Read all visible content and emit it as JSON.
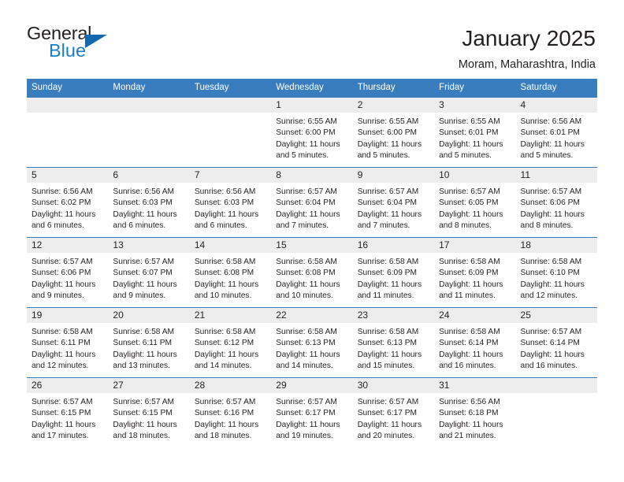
{
  "brand": {
    "name_part1": "General",
    "name_part2": "Blue",
    "triangle_color": "#1568b0",
    "blue_color": "#1a7ec8"
  },
  "header": {
    "title": "January 2025",
    "subtitle": "Moram, Maharashtra, India"
  },
  "theme": {
    "header_blue": "#3a7dbf",
    "daynum_bg": "#ededed",
    "text": "#231f20"
  },
  "weekdays": [
    "Sunday",
    "Monday",
    "Tuesday",
    "Wednesday",
    "Thursday",
    "Friday",
    "Saturday"
  ],
  "weeks": [
    [
      {
        "day": "",
        "blank": true
      },
      {
        "day": "",
        "blank": true
      },
      {
        "day": "",
        "blank": true
      },
      {
        "day": "1",
        "sunrise": "Sunrise: 6:55 AM",
        "sunset": "Sunset: 6:00 PM",
        "daylight1": "Daylight: 11 hours",
        "daylight2": "and 5 minutes."
      },
      {
        "day": "2",
        "sunrise": "Sunrise: 6:55 AM",
        "sunset": "Sunset: 6:00 PM",
        "daylight1": "Daylight: 11 hours",
        "daylight2": "and 5 minutes."
      },
      {
        "day": "3",
        "sunrise": "Sunrise: 6:55 AM",
        "sunset": "Sunset: 6:01 PM",
        "daylight1": "Daylight: 11 hours",
        "daylight2": "and 5 minutes."
      },
      {
        "day": "4",
        "sunrise": "Sunrise: 6:56 AM",
        "sunset": "Sunset: 6:01 PM",
        "daylight1": "Daylight: 11 hours",
        "daylight2": "and 5 minutes."
      }
    ],
    [
      {
        "day": "5",
        "sunrise": "Sunrise: 6:56 AM",
        "sunset": "Sunset: 6:02 PM",
        "daylight1": "Daylight: 11 hours",
        "daylight2": "and 6 minutes."
      },
      {
        "day": "6",
        "sunrise": "Sunrise: 6:56 AM",
        "sunset": "Sunset: 6:03 PM",
        "daylight1": "Daylight: 11 hours",
        "daylight2": "and 6 minutes."
      },
      {
        "day": "7",
        "sunrise": "Sunrise: 6:56 AM",
        "sunset": "Sunset: 6:03 PM",
        "daylight1": "Daylight: 11 hours",
        "daylight2": "and 6 minutes."
      },
      {
        "day": "8",
        "sunrise": "Sunrise: 6:57 AM",
        "sunset": "Sunset: 6:04 PM",
        "daylight1": "Daylight: 11 hours",
        "daylight2": "and 7 minutes."
      },
      {
        "day": "9",
        "sunrise": "Sunrise: 6:57 AM",
        "sunset": "Sunset: 6:04 PM",
        "daylight1": "Daylight: 11 hours",
        "daylight2": "and 7 minutes."
      },
      {
        "day": "10",
        "sunrise": "Sunrise: 6:57 AM",
        "sunset": "Sunset: 6:05 PM",
        "daylight1": "Daylight: 11 hours",
        "daylight2": "and 8 minutes."
      },
      {
        "day": "11",
        "sunrise": "Sunrise: 6:57 AM",
        "sunset": "Sunset: 6:06 PM",
        "daylight1": "Daylight: 11 hours",
        "daylight2": "and 8 minutes."
      }
    ],
    [
      {
        "day": "12",
        "sunrise": "Sunrise: 6:57 AM",
        "sunset": "Sunset: 6:06 PM",
        "daylight1": "Daylight: 11 hours",
        "daylight2": "and 9 minutes."
      },
      {
        "day": "13",
        "sunrise": "Sunrise: 6:57 AM",
        "sunset": "Sunset: 6:07 PM",
        "daylight1": "Daylight: 11 hours",
        "daylight2": "and 9 minutes."
      },
      {
        "day": "14",
        "sunrise": "Sunrise: 6:58 AM",
        "sunset": "Sunset: 6:08 PM",
        "daylight1": "Daylight: 11 hours",
        "daylight2": "and 10 minutes."
      },
      {
        "day": "15",
        "sunrise": "Sunrise: 6:58 AM",
        "sunset": "Sunset: 6:08 PM",
        "daylight1": "Daylight: 11 hours",
        "daylight2": "and 10 minutes."
      },
      {
        "day": "16",
        "sunrise": "Sunrise: 6:58 AM",
        "sunset": "Sunset: 6:09 PM",
        "daylight1": "Daylight: 11 hours",
        "daylight2": "and 11 minutes."
      },
      {
        "day": "17",
        "sunrise": "Sunrise: 6:58 AM",
        "sunset": "Sunset: 6:09 PM",
        "daylight1": "Daylight: 11 hours",
        "daylight2": "and 11 minutes."
      },
      {
        "day": "18",
        "sunrise": "Sunrise: 6:58 AM",
        "sunset": "Sunset: 6:10 PM",
        "daylight1": "Daylight: 11 hours",
        "daylight2": "and 12 minutes."
      }
    ],
    [
      {
        "day": "19",
        "sunrise": "Sunrise: 6:58 AM",
        "sunset": "Sunset: 6:11 PM",
        "daylight1": "Daylight: 11 hours",
        "daylight2": "and 12 minutes."
      },
      {
        "day": "20",
        "sunrise": "Sunrise: 6:58 AM",
        "sunset": "Sunset: 6:11 PM",
        "daylight1": "Daylight: 11 hours",
        "daylight2": "and 13 minutes."
      },
      {
        "day": "21",
        "sunrise": "Sunrise: 6:58 AM",
        "sunset": "Sunset: 6:12 PM",
        "daylight1": "Daylight: 11 hours",
        "daylight2": "and 14 minutes."
      },
      {
        "day": "22",
        "sunrise": "Sunrise: 6:58 AM",
        "sunset": "Sunset: 6:13 PM",
        "daylight1": "Daylight: 11 hours",
        "daylight2": "and 14 minutes."
      },
      {
        "day": "23",
        "sunrise": "Sunrise: 6:58 AM",
        "sunset": "Sunset: 6:13 PM",
        "daylight1": "Daylight: 11 hours",
        "daylight2": "and 15 minutes."
      },
      {
        "day": "24",
        "sunrise": "Sunrise: 6:58 AM",
        "sunset": "Sunset: 6:14 PM",
        "daylight1": "Daylight: 11 hours",
        "daylight2": "and 16 minutes."
      },
      {
        "day": "25",
        "sunrise": "Sunrise: 6:57 AM",
        "sunset": "Sunset: 6:14 PM",
        "daylight1": "Daylight: 11 hours",
        "daylight2": "and 16 minutes."
      }
    ],
    [
      {
        "day": "26",
        "sunrise": "Sunrise: 6:57 AM",
        "sunset": "Sunset: 6:15 PM",
        "daylight1": "Daylight: 11 hours",
        "daylight2": "and 17 minutes."
      },
      {
        "day": "27",
        "sunrise": "Sunrise: 6:57 AM",
        "sunset": "Sunset: 6:15 PM",
        "daylight1": "Daylight: 11 hours",
        "daylight2": "and 18 minutes."
      },
      {
        "day": "28",
        "sunrise": "Sunrise: 6:57 AM",
        "sunset": "Sunset: 6:16 PM",
        "daylight1": "Daylight: 11 hours",
        "daylight2": "and 18 minutes."
      },
      {
        "day": "29",
        "sunrise": "Sunrise: 6:57 AM",
        "sunset": "Sunset: 6:17 PM",
        "daylight1": "Daylight: 11 hours",
        "daylight2": "and 19 minutes."
      },
      {
        "day": "30",
        "sunrise": "Sunrise: 6:57 AM",
        "sunset": "Sunset: 6:17 PM",
        "daylight1": "Daylight: 11 hours",
        "daylight2": "and 20 minutes."
      },
      {
        "day": "31",
        "sunrise": "Sunrise: 6:56 AM",
        "sunset": "Sunset: 6:18 PM",
        "daylight1": "Daylight: 11 hours",
        "daylight2": "and 21 minutes."
      },
      {
        "day": "",
        "blank": true
      }
    ]
  ]
}
